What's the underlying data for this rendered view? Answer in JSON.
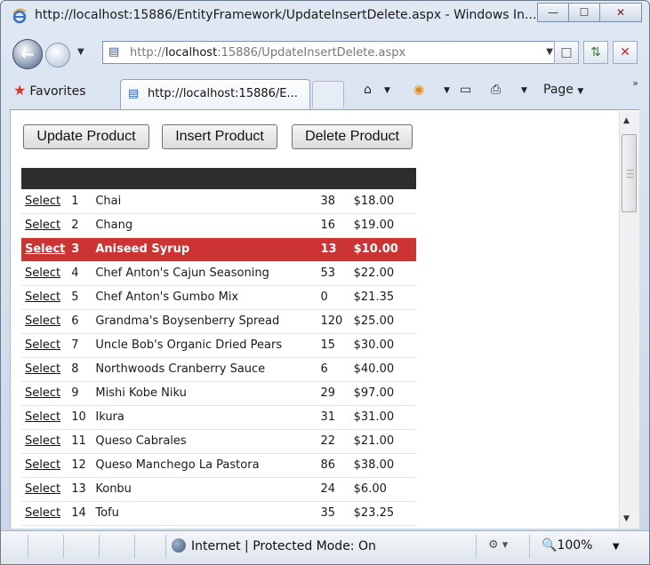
{
  "window": {
    "title": "http://localhost:15886/EntityFramework/UpdateInsertDelete.aspx - Windows In...",
    "minimize": "—",
    "maximize": "☐",
    "close": "✕"
  },
  "address": {
    "prefix": "http://",
    "host": "localhost",
    "rest": ":15886/UpdateInsertDelete.aspx"
  },
  "tabs": {
    "favorites_label": "Favorites",
    "active_tab_label": "http://localhost:15886/E...",
    "page_menu_label": "Page"
  },
  "toolbar_buttons": {
    "update": "Update Product",
    "insert": "Insert Product",
    "delete": "Delete Product"
  },
  "grid": {
    "select_label": "Select",
    "selected_index": 2,
    "rows": [
      {
        "id": "1",
        "name": "Chai",
        "stock": "38",
        "price": "$18.00"
      },
      {
        "id": "2",
        "name": "Chang",
        "stock": "16",
        "price": "$19.00"
      },
      {
        "id": "3",
        "name": "Aniseed Syrup",
        "stock": "13",
        "price": "$10.00"
      },
      {
        "id": "4",
        "name": "Chef Anton's Cajun Seasoning",
        "stock": "53",
        "price": "$22.00"
      },
      {
        "id": "5",
        "name": "Chef Anton's Gumbo Mix",
        "stock": "0",
        "price": "$21.35"
      },
      {
        "id": "6",
        "name": "Grandma's Boysenberry Spread",
        "stock": "120",
        "price": "$25.00"
      },
      {
        "id": "7",
        "name": "Uncle Bob's Organic Dried Pears",
        "stock": "15",
        "price": "$30.00"
      },
      {
        "id": "8",
        "name": "Northwoods Cranberry Sauce",
        "stock": "6",
        "price": "$40.00"
      },
      {
        "id": "9",
        "name": "Mishi Kobe Niku",
        "stock": "29",
        "price": "$97.00"
      },
      {
        "id": "10",
        "name": "Ikura",
        "stock": "31",
        "price": "$31.00"
      },
      {
        "id": "11",
        "name": "Queso Cabrales",
        "stock": "22",
        "price": "$21.00"
      },
      {
        "id": "12",
        "name": "Queso Manchego La Pastora",
        "stock": "86",
        "price": "$38.00"
      },
      {
        "id": "13",
        "name": "Konbu",
        "stock": "24",
        "price": "$6.00"
      },
      {
        "id": "14",
        "name": "Tofu",
        "stock": "35",
        "price": "$23.25"
      }
    ]
  },
  "status": {
    "zone": "Internet | Protected Mode: On",
    "zoom": "100%"
  },
  "colors": {
    "selected_row": "#cc3333",
    "header_row": "#2d2d2d"
  }
}
